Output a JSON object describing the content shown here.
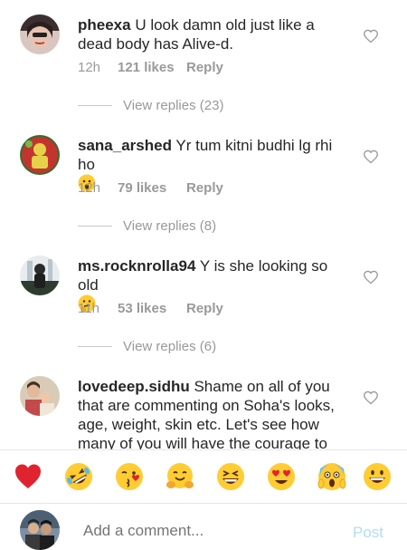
{
  "comments": [
    {
      "username": "pheexa",
      "text": " U look damn old just like a dead body has Alive-d.",
      "time": "12h",
      "likes": "121 likes",
      "reply": "Reply",
      "view_replies": "View replies (23)",
      "avatar_icon": "user-avatar-pheexa"
    },
    {
      "username": "sana_arshed",
      "text": " Yr tum kitni budhi lg rhi ho",
      "emoji": "astonished-face-emoji",
      "time": "12h",
      "likes": "79 likes",
      "reply": "Reply",
      "view_replies": "View replies (8)",
      "avatar_icon": "user-avatar-sana"
    },
    {
      "username": "ms.rocknrolla94",
      "text": " Y is she looking so old",
      "emoji": "thinking-face-emoji",
      "time": "11h",
      "likes": "53 likes",
      "reply": "Reply",
      "view_replies": "View replies (6)",
      "avatar_icon": "user-avatar-rocknrolla"
    },
    {
      "username": "lovedeep.sidhu",
      "text": " Shame on all of you that are commenting on Soha's looks, age, weight, skin etc. Let's see how many of you will have the courage to post a",
      "avatar_icon": "user-avatar-lovedeep"
    }
  ],
  "emoji_bar": [
    "red-heart-emoji",
    "rolling-laughing-emoji",
    "kissing-wink-emoji",
    "hugging-face-emoji",
    "squinting-laugh-emoji",
    "heart-eyes-emoji",
    "screaming-fear-emoji",
    "grinning-face-emoji"
  ],
  "composer": {
    "placeholder": "Add a comment...",
    "post_label": "Post"
  },
  "colors": {
    "text": "#262626",
    "meta": "#999999",
    "post_disabled": "#b3dbff",
    "heart_red": "#ed4956",
    "emoji_yellow": "#ffcc33"
  }
}
